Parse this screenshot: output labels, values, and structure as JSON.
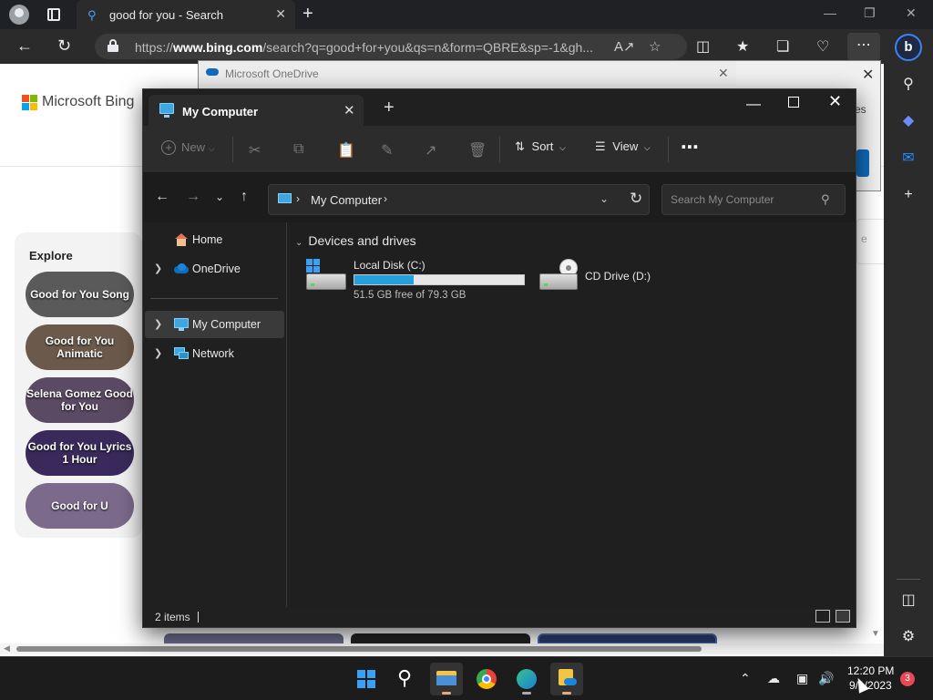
{
  "browser": {
    "tab_title": "good for you - Search",
    "url_prefix": "https://",
    "url_domain": "www.bing.com",
    "url_rest": "/search?q=good+for+you&qs=n&form=QBRE&sp=-1&gh..."
  },
  "bing": {
    "logo_text": "Microsoft Bing",
    "explore_title": "Explore",
    "explore_items": [
      {
        "label": "Good for You Song",
        "color": "#5a5a5a"
      },
      {
        "label": "Good for You Animatic",
        "color": "#6b5a4c"
      },
      {
        "label": "Selena Gomez Good for You",
        "color": "#5b4a63"
      },
      {
        "label": "Good for You Lyrics 1 Hour",
        "color": "#3a2a5c"
      },
      {
        "label": "Good for U",
        "color": "#7b6a8a"
      }
    ],
    "right_fragment": "e"
  },
  "onedrive": {
    "title": "Microsoft OneDrive",
    "side_text": "es"
  },
  "explorer": {
    "tab_title": "My Computer",
    "toolbar": {
      "new_label": "New",
      "sort_label": "Sort",
      "view_label": "View"
    },
    "address": "My Computer",
    "search_placeholder": "Search My Computer",
    "nav": [
      {
        "label": "Home"
      },
      {
        "label": "OneDrive"
      },
      {
        "label": "My Computer"
      },
      {
        "label": "Network"
      }
    ],
    "group_title": "Devices and drives",
    "drives": [
      {
        "name": "Local Disk (C:)",
        "free": "51.5 GB free of 79.3 GB",
        "used_fraction": 0.35
      },
      {
        "name": "CD Drive (D:)"
      }
    ],
    "status": "2 items"
  },
  "taskbar": {
    "time": "12:20 PM",
    "date": "9/1/2023",
    "notifications": "3"
  },
  "colors": {
    "accent": "#26a0da",
    "edge_blue": "#3b82f6"
  }
}
